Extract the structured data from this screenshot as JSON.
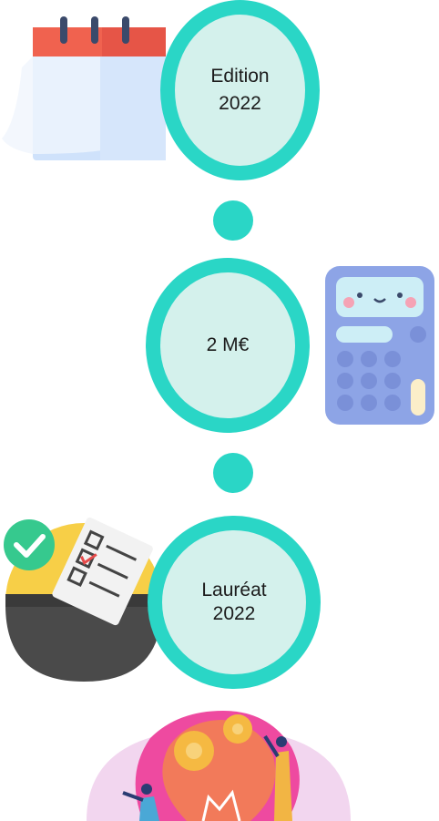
{
  "timeline": {
    "items": [
      {
        "line1": "Edition",
        "line2": "2022",
        "icon": "calendar-icon"
      },
      {
        "line1": "2 M€",
        "icon": "calculator-icon"
      },
      {
        "line1": "Lauréat",
        "line2": "2022",
        "icon": "ballot-box-icon"
      }
    ],
    "footer_icon": "innovation-lightbulb-icon"
  },
  "colors": {
    "ring": "#2ad6c6",
    "ring_fill": "#d4f1ec",
    "calendar_red": "#f0624f",
    "calculator_blue": "#8da4e6",
    "check_green": "#36c98e",
    "lightbulb_pink": "#ee4aa0"
  }
}
